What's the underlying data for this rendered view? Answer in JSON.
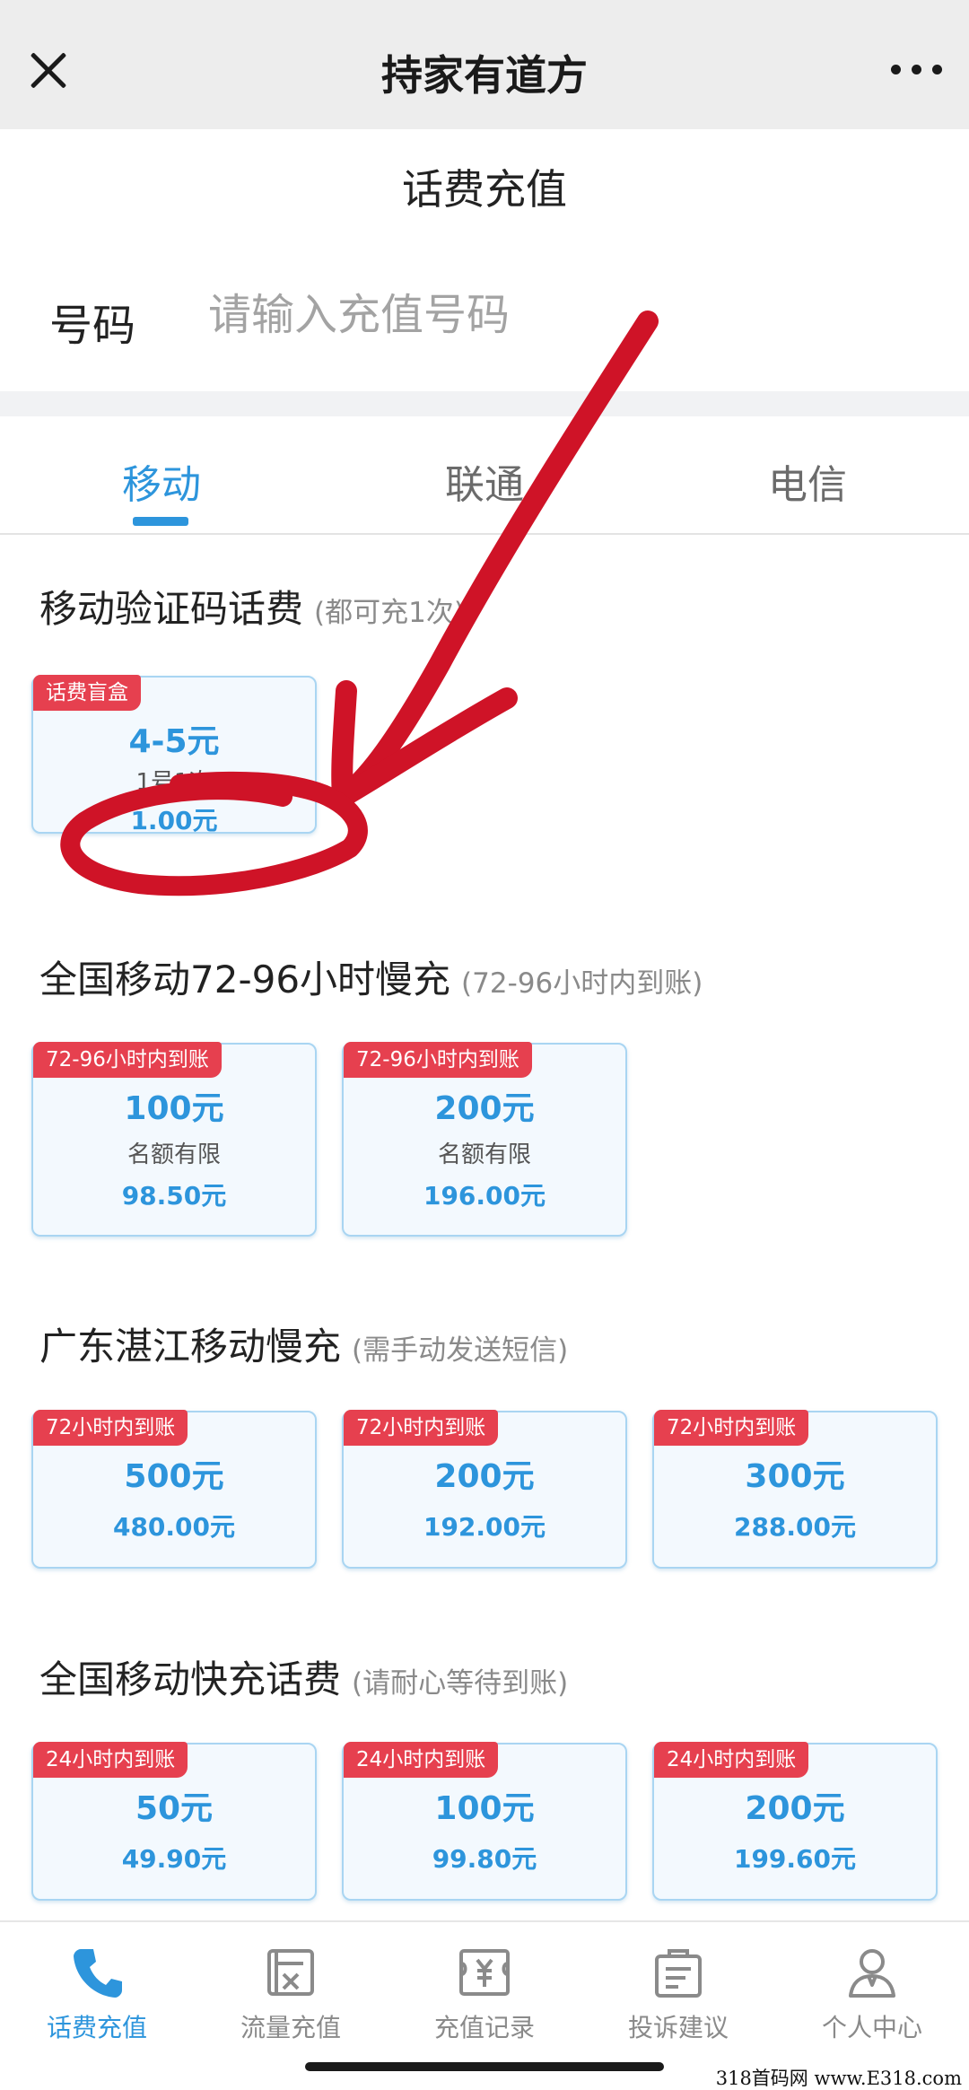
{
  "header": {
    "title": "持家有道方"
  },
  "page": {
    "title": "话费充值"
  },
  "phone": {
    "label": "号码",
    "placeholder": "请输入充值号码"
  },
  "tabs": [
    {
      "label": "移动",
      "active": true
    },
    {
      "label": "联通",
      "active": false
    },
    {
      "label": "电信",
      "active": false
    }
  ],
  "sections": [
    {
      "title": "移动验证码话费",
      "note": "(都可充1次)",
      "cards": [
        {
          "badge": "话费盲盒",
          "face": "4-5元",
          "desc": "1号1次",
          "price": "1.00元"
        }
      ]
    },
    {
      "title": "全国移动72-96小时慢充",
      "note": "(72-96小时内到账)",
      "cards": [
        {
          "badge": "72-96小时内到账",
          "face": "100元",
          "desc": "名额有限",
          "price": "98.50元"
        },
        {
          "badge": "72-96小时内到账",
          "face": "200元",
          "desc": "名额有限",
          "price": "196.00元"
        }
      ]
    },
    {
      "title": "广东湛江移动慢充",
      "note": "(需手动发送短信)",
      "cards": [
        {
          "badge": "72小时内到账",
          "face": "500元",
          "price": "480.00元"
        },
        {
          "badge": "72小时内到账",
          "face": "200元",
          "price": "192.00元"
        },
        {
          "badge": "72小时内到账",
          "face": "300元",
          "price": "288.00元"
        }
      ]
    },
    {
      "title": "全国移动快充话费",
      "note": "(请耐心等待到账)",
      "cards": [
        {
          "badge": "24小时内到账",
          "face": "50元",
          "price": "49.90元"
        },
        {
          "badge": "24小时内到账",
          "face": "100元",
          "price": "99.80元"
        },
        {
          "badge": "24小时内到账",
          "face": "200元",
          "price": "199.60元"
        }
      ]
    }
  ],
  "bottom_nav": [
    {
      "label": "话费充值",
      "icon": "phone-icon",
      "active": true
    },
    {
      "label": "流量充值",
      "icon": "traffic-icon",
      "active": false
    },
    {
      "label": "充值记录",
      "icon": "record-icon",
      "active": false
    },
    {
      "label": "投诉建议",
      "icon": "complaint-icon",
      "active": false
    },
    {
      "label": "个人中心",
      "icon": "user-icon",
      "active": false
    }
  ],
  "watermark": "318首码网 www.E318.com",
  "colors": {
    "accent": "#2d95dc",
    "badge": "#e6404f",
    "annotation": "#cf1327"
  }
}
